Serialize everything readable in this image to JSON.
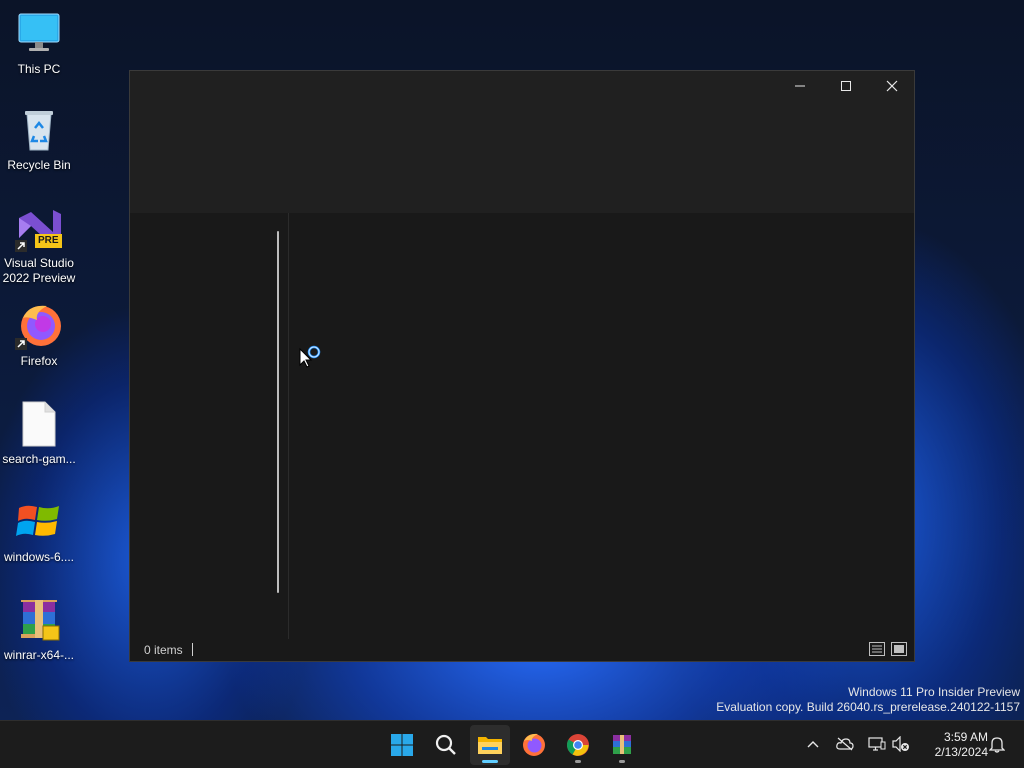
{
  "desktop": {
    "icons": [
      {
        "label": "This PC",
        "icon": "monitor-icon"
      },
      {
        "label": "Recycle Bin",
        "icon": "recycle-bin-icon"
      },
      {
        "label": "Visual Studio 2022 Preview",
        "line1": "Visual Studio",
        "line2": "2022 Preview",
        "badge": "PRE",
        "icon": "visual-studio-icon"
      },
      {
        "label": "Firefox",
        "icon": "firefox-icon"
      },
      {
        "label": "search-gam...",
        "icon": "file-icon"
      },
      {
        "label": "windows-6....",
        "icon": "windows-logo-icon"
      },
      {
        "label": "winrar-x64-...",
        "icon": "winrar-icon"
      }
    ]
  },
  "explorer": {
    "status": {
      "items": "0 items"
    },
    "state": "loading"
  },
  "watermark": {
    "line1": "Windows 11 Pro Insider Preview",
    "line2": "Evaluation copy. Build 26040.rs_prerelease.240122-1157"
  },
  "taskbar": {
    "apps": [
      {
        "name": "Start",
        "icon": "windows-start-icon"
      },
      {
        "name": "Search",
        "icon": "search-icon"
      },
      {
        "name": "File Explorer",
        "icon": "folder-icon",
        "active": true
      },
      {
        "name": "Firefox",
        "icon": "firefox-icon"
      },
      {
        "name": "Chrome",
        "icon": "chrome-icon",
        "running": true
      },
      {
        "name": "WinRAR",
        "icon": "winrar-icon",
        "running": true
      }
    ],
    "tray": {
      "time": "3:59 AM",
      "date": "2/13/2024"
    }
  },
  "colors": {
    "accent": "#0078d4",
    "window_bg": "#191919",
    "titlebar_bg": "#202020",
    "taskbar_bg": "#1c1c1c"
  }
}
